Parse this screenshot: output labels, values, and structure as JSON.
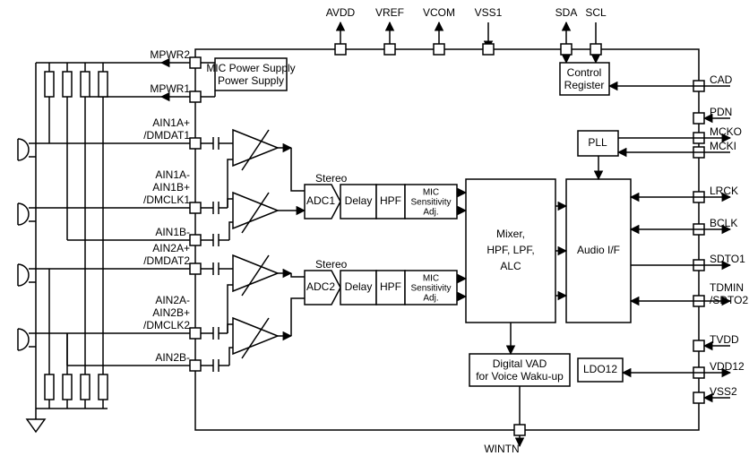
{
  "top_pins": {
    "avdd": "AVDD",
    "vref": "VREF",
    "vcom": "VCOM",
    "vss1": "VSS1",
    "sda": "SDA",
    "scl": "SCL"
  },
  "bottom_pin": {
    "wintn": "WINTN"
  },
  "left_pins": {
    "mpwr2": "MPWR2",
    "mpwr1": "MPWR1",
    "ain1ap": "AIN1A+",
    "dmdat1": "/DMDAT1",
    "ain1am": "AIN1A-",
    "ain1bp": "AIN1B+",
    "dmclk1": "/DMCLK1",
    "ain1bm": "AIN1B-",
    "ain2ap": "AIN2A+",
    "dmdat2": "/DMDAT2",
    "ain2am": "AIN2A-",
    "ain2bp": "AIN2B+",
    "dmclk2": "/DMCLK2",
    "ain2bm": "AIN2B-"
  },
  "right_pins": {
    "cad": "CAD",
    "pdn": "PDN",
    "mcko": "MCKO",
    "mcki": "MCKI",
    "lrck": "LRCK",
    "bclk": "BCLK",
    "sdto1": "SDTO1",
    "tdmin": "TDMIN",
    "sdto2": "/SDTO2",
    "tvdd": "TVDD",
    "vdd12": "VDD12",
    "vss2": "VSS2"
  },
  "blocks": {
    "mic_ps": "MIC\nPower Supply",
    "ctrl_reg": "Control\nRegister",
    "pll": "PLL",
    "stereo": "Stereo",
    "adc1": "ADC1",
    "adc2": "ADC2",
    "delay": "Delay",
    "hpf": "HPF",
    "sens": "MIC\nSensitivity\nAdj.",
    "mixer": "Mixer,\nHPF, LPF,\nALC",
    "audio_if": "Audio I/F",
    "vad": "Digital VAD\nfor Voice Waku-up",
    "ldo": "LDO12"
  }
}
